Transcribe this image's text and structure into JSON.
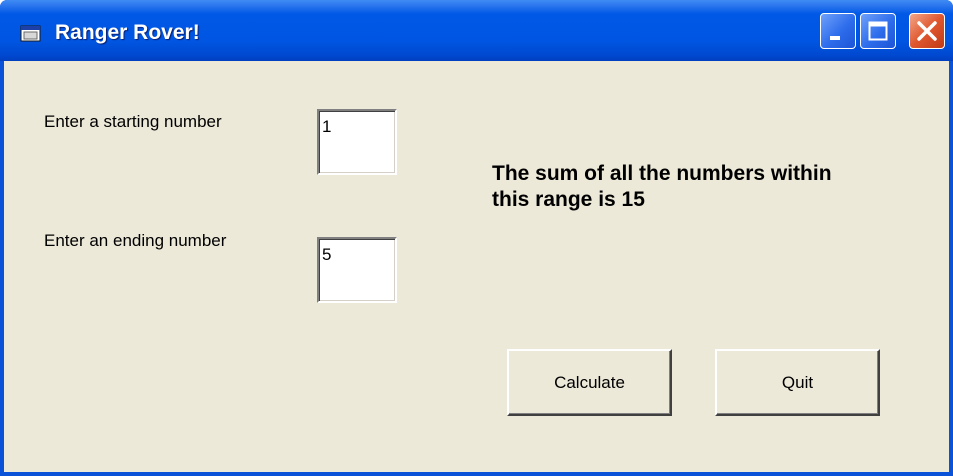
{
  "window": {
    "title": "Ranger Rover!",
    "colors": {
      "titlebar": "#0058E6",
      "client": "#ECE9D8",
      "close": "#E0572F"
    }
  },
  "controls": {
    "start_label": "Enter a starting number",
    "start_value": "1",
    "end_label": "Enter an ending number",
    "end_value": "5",
    "result_text": "The sum of all the numbers within this range is 15"
  },
  "buttons": {
    "calculate": "Calculate",
    "quit": "Quit"
  },
  "icons": {
    "app": "app-window-icon",
    "minimize": "minimize-icon",
    "maximize": "maximize-icon",
    "close": "close-icon"
  }
}
